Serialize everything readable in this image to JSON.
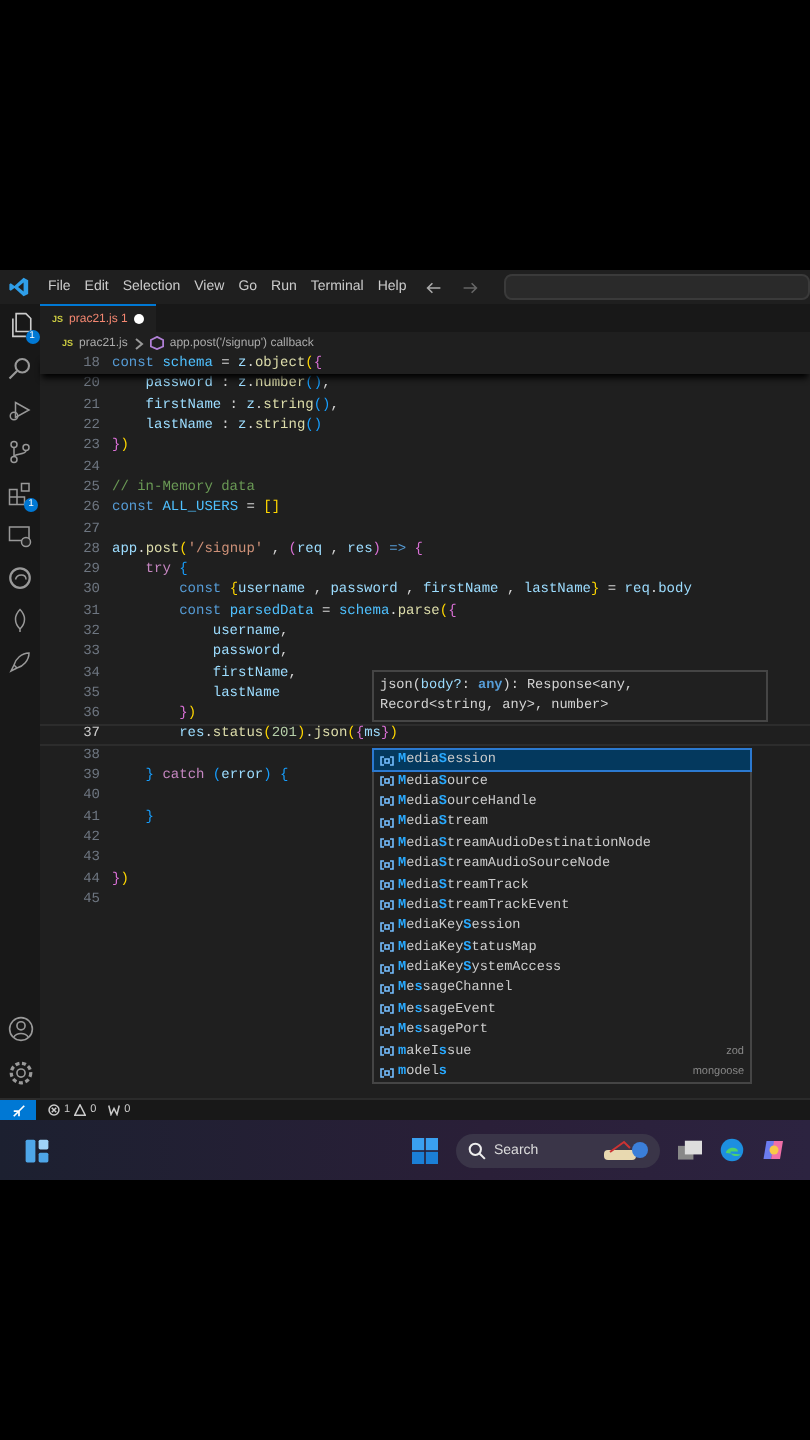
{
  "menu": [
    "File",
    "Edit",
    "Selection",
    "View",
    "Go",
    "Run",
    "Terminal",
    "Help"
  ],
  "activity_bar": {
    "explorer_badge": "1",
    "extensions_badge": "1"
  },
  "tabs": [
    {
      "icon_text": "JS",
      "label": "prac21.js",
      "problems": "1",
      "modified": true,
      "selected": true
    }
  ],
  "breadcrumb": {
    "icon_text": "JS",
    "file": "prac21.js",
    "symbol": "app.post('/signup') callback"
  },
  "sticky_line": {
    "n": "18",
    "tokens": [
      {
        "t": "const ",
        "kind": "kw"
      },
      {
        "t": "schema",
        "kind": "cst"
      },
      {
        "t": " = ",
        "kind": "p"
      },
      {
        "t": "z",
        "kind": "var"
      },
      {
        "t": ".",
        "kind": "p"
      },
      {
        "t": "object",
        "kind": "fn"
      },
      {
        "t": "(",
        "kind": "b1"
      },
      {
        "t": "{",
        "kind": "b2"
      }
    ]
  },
  "lines": [
    {
      "n": "20",
      "current": false,
      "tokens": [
        {
          "t": "    password",
          "kind": "var"
        },
        {
          "t": " : ",
          "kind": "p"
        },
        {
          "t": "z",
          "kind": "var"
        },
        {
          "t": ".",
          "kind": "p"
        },
        {
          "t": "number",
          "kind": "fn"
        },
        {
          "t": "()",
          "kind": "b3"
        },
        {
          "t": ",",
          "kind": "p"
        }
      ]
    },
    {
      "n": "21",
      "current": false,
      "tokens": [
        {
          "t": "    firstName",
          "kind": "var"
        },
        {
          "t": " : ",
          "kind": "p"
        },
        {
          "t": "z",
          "kind": "var"
        },
        {
          "t": ".",
          "kind": "p"
        },
        {
          "t": "string",
          "kind": "fn"
        },
        {
          "t": "()",
          "kind": "b3"
        },
        {
          "t": ",",
          "kind": "p"
        }
      ]
    },
    {
      "n": "22",
      "current": false,
      "tokens": [
        {
          "t": "    lastName",
          "kind": "var"
        },
        {
          "t": " : ",
          "kind": "p"
        },
        {
          "t": "z",
          "kind": "var"
        },
        {
          "t": ".",
          "kind": "p"
        },
        {
          "t": "string",
          "kind": "fn"
        },
        {
          "t": "()",
          "kind": "b3"
        }
      ]
    },
    {
      "n": "23",
      "current": false,
      "tokens": [
        {
          "t": "}",
          "kind": "b2"
        },
        {
          "t": ")",
          "kind": "b1"
        }
      ]
    },
    {
      "n": "24",
      "current": false
    },
    {
      "n": "25",
      "current": false,
      "tokens": [
        {
          "t": "// in-Memory data",
          "kind": "cmt"
        }
      ]
    },
    {
      "n": "26",
      "current": false,
      "tokens": [
        {
          "t": "const ",
          "kind": "kw"
        },
        {
          "t": "ALL_USERS",
          "kind": "cst"
        },
        {
          "t": " = ",
          "kind": "p"
        },
        {
          "t": "[]",
          "kind": "b1"
        }
      ]
    },
    {
      "n": "27",
      "current": false
    },
    {
      "n": "28",
      "current": false,
      "tokens": [
        {
          "t": "app",
          "kind": "var"
        },
        {
          "t": ".",
          "kind": "p"
        },
        {
          "t": "post",
          "kind": "fn"
        },
        {
          "t": "(",
          "kind": "b1"
        },
        {
          "t": "'/signup'",
          "kind": "str"
        },
        {
          "t": " , ",
          "kind": "p"
        },
        {
          "t": "(",
          "kind": "b2"
        },
        {
          "t": "req",
          "kind": "var"
        },
        {
          "t": " , ",
          "kind": "p"
        },
        {
          "t": "res",
          "kind": "var"
        },
        {
          "t": ")",
          "kind": "b2"
        },
        {
          "t": " => ",
          "kind": "kw"
        },
        {
          "t": "{",
          "kind": "b2"
        }
      ]
    },
    {
      "n": "29",
      "current": false,
      "tokens": [
        {
          "t": "    try ",
          "kind": "ctl"
        },
        {
          "t": "{",
          "kind": "b3"
        }
      ]
    },
    {
      "n": "30",
      "current": false,
      "tokens": [
        {
          "t": "        const ",
          "kind": "kw"
        },
        {
          "t": "{",
          "kind": "b1"
        },
        {
          "t": "username",
          "kind": "var"
        },
        {
          "t": " , ",
          "kind": "p"
        },
        {
          "t": "password",
          "kind": "var"
        },
        {
          "t": " , ",
          "kind": "p"
        },
        {
          "t": "firstName",
          "kind": "var"
        },
        {
          "t": " , ",
          "kind": "p"
        },
        {
          "t": "lastName",
          "kind": "var"
        },
        {
          "t": "}",
          "kind": "b1"
        },
        {
          "t": " = ",
          "kind": "p"
        },
        {
          "t": "req",
          "kind": "var"
        },
        {
          "t": ".",
          "kind": "p"
        },
        {
          "t": "body",
          "kind": "var"
        }
      ]
    },
    {
      "n": "31",
      "current": false,
      "tokens": [
        {
          "t": "        const ",
          "kind": "kw"
        },
        {
          "t": "parsedData",
          "kind": "cst"
        },
        {
          "t": " = ",
          "kind": "p"
        },
        {
          "t": "schema",
          "kind": "cst"
        },
        {
          "t": ".",
          "kind": "p"
        },
        {
          "t": "parse",
          "kind": "fn"
        },
        {
          "t": "(",
          "kind": "b1"
        },
        {
          "t": "{",
          "kind": "b2"
        }
      ]
    },
    {
      "n": "32",
      "current": false,
      "tokens": [
        {
          "t": "            username",
          "kind": "var"
        },
        {
          "t": ",",
          "kind": "p"
        }
      ]
    },
    {
      "n": "33",
      "current": false,
      "tokens": [
        {
          "t": "            password",
          "kind": "var"
        },
        {
          "t": ",",
          "kind": "p"
        }
      ]
    },
    {
      "n": "34",
      "current": false,
      "tokens": [
        {
          "t": "            firstName",
          "kind": "var"
        },
        {
          "t": ",",
          "kind": "p"
        }
      ]
    },
    {
      "n": "35",
      "current": false,
      "tokens": [
        {
          "t": "            lastName",
          "kind": "var"
        }
      ]
    },
    {
      "n": "36",
      "current": false,
      "tokens": [
        {
          "t": "        }",
          "kind": "b2"
        },
        {
          "t": ")",
          "kind": "b1"
        }
      ]
    },
    {
      "n": "37",
      "current": true,
      "tokens": [
        {
          "t": "        res",
          "kind": "var"
        },
        {
          "t": ".",
          "kind": "p"
        },
        {
          "t": "status",
          "kind": "fn"
        },
        {
          "t": "(",
          "kind": "b1"
        },
        {
          "t": "201",
          "kind": "num"
        },
        {
          "t": ")",
          "kind": "b1"
        },
        {
          "t": ".",
          "kind": "p"
        },
        {
          "t": "json",
          "kind": "fn"
        },
        {
          "t": "(",
          "kind": "b1"
        },
        {
          "t": "{",
          "kind": "b2"
        },
        {
          "t": "ms",
          "kind": "var"
        },
        {
          "t": "}",
          "kind": "b2"
        },
        {
          "t": ")",
          "kind": "b1"
        }
      ]
    },
    {
      "n": "38",
      "current": false
    },
    {
      "n": "39",
      "current": false,
      "tokens": [
        {
          "t": "    }",
          "kind": "b3"
        },
        {
          "t": " catch ",
          "kind": "ctl"
        },
        {
          "t": "(",
          "kind": "b3"
        },
        {
          "t": "error",
          "kind": "var"
        },
        {
          "t": ")",
          "kind": "b3"
        },
        {
          "t": " {",
          "kind": "b3"
        }
      ]
    },
    {
      "n": "40",
      "current": false
    },
    {
      "n": "41",
      "current": false,
      "tokens": [
        {
          "t": "    }",
          "kind": "b3"
        }
      ]
    },
    {
      "n": "42",
      "current": false
    },
    {
      "n": "43",
      "current": false
    },
    {
      "n": "44",
      "current": false,
      "tokens": [
        {
          "t": "}",
          "kind": "b2"
        },
        {
          "t": ")",
          "kind": "b1"
        }
      ]
    },
    {
      "n": "45",
      "current": false
    }
  ],
  "signature_hint": {
    "lines": [
      [
        {
          "t": "json(",
          "kind": "p"
        },
        {
          "t": "body?",
          "kind": "var"
        },
        {
          "t": ": ",
          "kind": "p"
        },
        {
          "t": "any",
          "kind": "kw"
        },
        {
          "t": "): Response<any,",
          "kind": "p"
        }
      ],
      [
        {
          "t": "Record<string, any>, number>",
          "kind": "p"
        }
      ]
    ]
  },
  "suggestions": [
    {
      "selected": true,
      "parts": [
        {
          "t": "M",
          "match": true
        },
        {
          "t": "edia",
          "match": false
        },
        {
          "t": "S",
          "match": true
        },
        {
          "t": "ession",
          "match": false
        }
      ]
    },
    {
      "selected": false,
      "parts": [
        {
          "t": "M",
          "match": true
        },
        {
          "t": "edia",
          "match": false
        },
        {
          "t": "S",
          "match": true
        },
        {
          "t": "ource",
          "match": false
        }
      ]
    },
    {
      "selected": false,
      "parts": [
        {
          "t": "M",
          "match": true
        },
        {
          "t": "edia",
          "match": false
        },
        {
          "t": "S",
          "match": true
        },
        {
          "t": "ourceHandle",
          "match": false
        }
      ]
    },
    {
      "selected": false,
      "parts": [
        {
          "t": "M",
          "match": true
        },
        {
          "t": "edia",
          "match": false
        },
        {
          "t": "S",
          "match": true
        },
        {
          "t": "tream",
          "match": false
        }
      ]
    },
    {
      "selected": false,
      "parts": [
        {
          "t": "M",
          "match": true
        },
        {
          "t": "edia",
          "match": false
        },
        {
          "t": "S",
          "match": true
        },
        {
          "t": "treamAudioDestinationNode",
          "match": false
        }
      ]
    },
    {
      "selected": false,
      "parts": [
        {
          "t": "M",
          "match": true
        },
        {
          "t": "edia",
          "match": false
        },
        {
          "t": "S",
          "match": true
        },
        {
          "t": "treamAudioSourceNode",
          "match": false
        }
      ]
    },
    {
      "selected": false,
      "parts": [
        {
          "t": "M",
          "match": true
        },
        {
          "t": "edia",
          "match": false
        },
        {
          "t": "S",
          "match": true
        },
        {
          "t": "treamTrack",
          "match": false
        }
      ]
    },
    {
      "selected": false,
      "parts": [
        {
          "t": "M",
          "match": true
        },
        {
          "t": "edia",
          "match": false
        },
        {
          "t": "S",
          "match": true
        },
        {
          "t": "treamTrackEvent",
          "match": false
        }
      ]
    },
    {
      "selected": false,
      "parts": [
        {
          "t": "M",
          "match": true
        },
        {
          "t": "ediaKey",
          "match": false
        },
        {
          "t": "S",
          "match": true
        },
        {
          "t": "ession",
          "match": false
        }
      ]
    },
    {
      "selected": false,
      "parts": [
        {
          "t": "M",
          "match": true
        },
        {
          "t": "ediaKey",
          "match": false
        },
        {
          "t": "S",
          "match": true
        },
        {
          "t": "tatusMap",
          "match": false
        }
      ]
    },
    {
      "selected": false,
      "parts": [
        {
          "t": "M",
          "match": true
        },
        {
          "t": "ediaKey",
          "match": false
        },
        {
          "t": "S",
          "match": true
        },
        {
          "t": "ystemAccess",
          "match": false
        }
      ]
    },
    {
      "selected": false,
      "parts": [
        {
          "t": "M",
          "match": true
        },
        {
          "t": "e",
          "match": false
        },
        {
          "t": "s",
          "match": true
        },
        {
          "t": "sageChannel",
          "match": false
        }
      ]
    },
    {
      "selected": false,
      "parts": [
        {
          "t": "M",
          "match": true
        },
        {
          "t": "e",
          "match": false
        },
        {
          "t": "s",
          "match": true
        },
        {
          "t": "sageEvent",
          "match": false
        }
      ]
    },
    {
      "selected": false,
      "parts": [
        {
          "t": "M",
          "match": true
        },
        {
          "t": "e",
          "match": false
        },
        {
          "t": "s",
          "match": true
        },
        {
          "t": "sagePort",
          "match": false
        }
      ]
    },
    {
      "selected": false,
      "source": "zod",
      "parts": [
        {
          "t": "m",
          "match": true
        },
        {
          "t": "akeI",
          "match": false
        },
        {
          "t": "s",
          "match": true
        },
        {
          "t": "sue",
          "match": false
        }
      ]
    },
    {
      "selected": false,
      "source": "mongoose",
      "parts": [
        {
          "t": "m",
          "match": true
        },
        {
          "t": "odel",
          "match": false
        },
        {
          "t": "s",
          "match": true
        }
      ]
    }
  ],
  "status_bar": {
    "errors": "1",
    "warnings": "0",
    "ports": "0"
  },
  "taskbar": {
    "search_placeholder": "Search"
  }
}
